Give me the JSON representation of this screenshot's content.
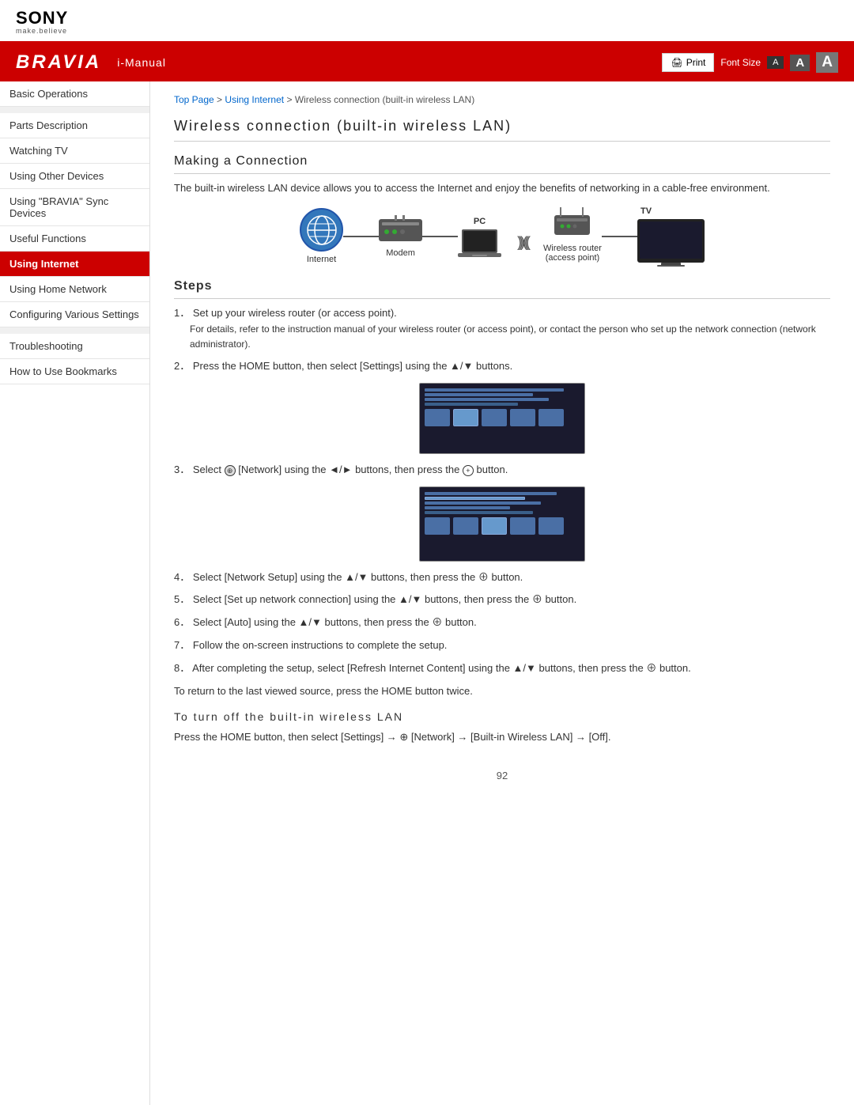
{
  "brand": {
    "name": "SONY",
    "tagline": "make.believe",
    "product": "BRAVIA",
    "manual": "i-Manual"
  },
  "header": {
    "print_label": "Print",
    "font_size_label": "Font Size",
    "font_small": "A",
    "font_medium": "A",
    "font_large": "A"
  },
  "breadcrumb": {
    "top_page": "Top Page",
    "separator1": " > ",
    "using_internet": "Using Internet",
    "separator2": " > ",
    "current": "Wireless connection (built-in wireless LAN)"
  },
  "sidebar": {
    "items": [
      {
        "id": "basic-operations",
        "label": "Basic Operations",
        "active": false
      },
      {
        "id": "parts-description",
        "label": "Parts Description",
        "active": false
      },
      {
        "id": "watching-tv",
        "label": "Watching TV",
        "active": false
      },
      {
        "id": "using-other-devices",
        "label": "Using Other Devices",
        "active": false
      },
      {
        "id": "using-bravia-sync",
        "label": "Using \"BRAVIA\" Sync Devices",
        "active": false
      },
      {
        "id": "useful-functions",
        "label": "Useful Functions",
        "active": false
      },
      {
        "id": "using-internet",
        "label": "Using Internet",
        "active": true
      },
      {
        "id": "using-home-network",
        "label": "Using Home Network",
        "active": false
      },
      {
        "id": "configuring-settings",
        "label": "Configuring Various Settings",
        "active": false
      },
      {
        "id": "troubleshooting",
        "label": "Troubleshooting",
        "active": false
      },
      {
        "id": "bookmarks",
        "label": "How to Use Bookmarks",
        "active": false
      }
    ]
  },
  "content": {
    "page_title": "Wireless connection (built-in wireless LAN)",
    "section_making": "Making a Connection",
    "intro_text": "The built-in wireless LAN device allows you to access the Internet and enjoy the benefits of networking in a cable-free environment.",
    "diagram": {
      "internet_label": "Internet",
      "modem_label": "Modem",
      "pc_label": "PC",
      "tv_label": "TV",
      "router_label": "Wireless router\n(access point)"
    },
    "steps_title": "Steps",
    "steps": [
      {
        "num": "1",
        "text": "Set up your wireless router (or access point).",
        "sub": "For details, refer to the instruction manual of your wireless router (or access point), or contact the person who set up the network connection (network administrator)."
      },
      {
        "num": "2",
        "text": "Press the HOME button, then select [Settings] using the ▲/▼ buttons.",
        "has_image": true
      },
      {
        "num": "3",
        "text": "Select  [Network] using the ◄/► buttons, then press the ⊕ button.",
        "has_image": true
      },
      {
        "num": "4",
        "text": "Select [Network Setup] using the ▲/▼ buttons, then press the ⊕ button.",
        "has_image": false
      },
      {
        "num": "5",
        "text": "Select [Set up network connection] using the ▲/▼ buttons, then press the ⊕ button.",
        "has_image": false
      },
      {
        "num": "6",
        "text": "Select [Auto] using the ▲/▼ buttons, then press the ⊕ button.",
        "has_image": false
      },
      {
        "num": "7",
        "text": "Follow the on-screen instructions to complete the setup.",
        "has_image": false
      },
      {
        "num": "8",
        "text": "After completing the setup, select [Refresh Internet Content] using the ▲/▼ buttons, then press the ⊕ button.",
        "has_image": false
      }
    ],
    "return_text": "To return to the last viewed source, press the HOME button twice.",
    "sub_title": "To turn off the built-in wireless LAN",
    "sub_text": "Press the HOME button, then select [Settings] → ⊕ [Network] → [Built-in Wireless LAN] → [Off].",
    "page_number": "92"
  }
}
